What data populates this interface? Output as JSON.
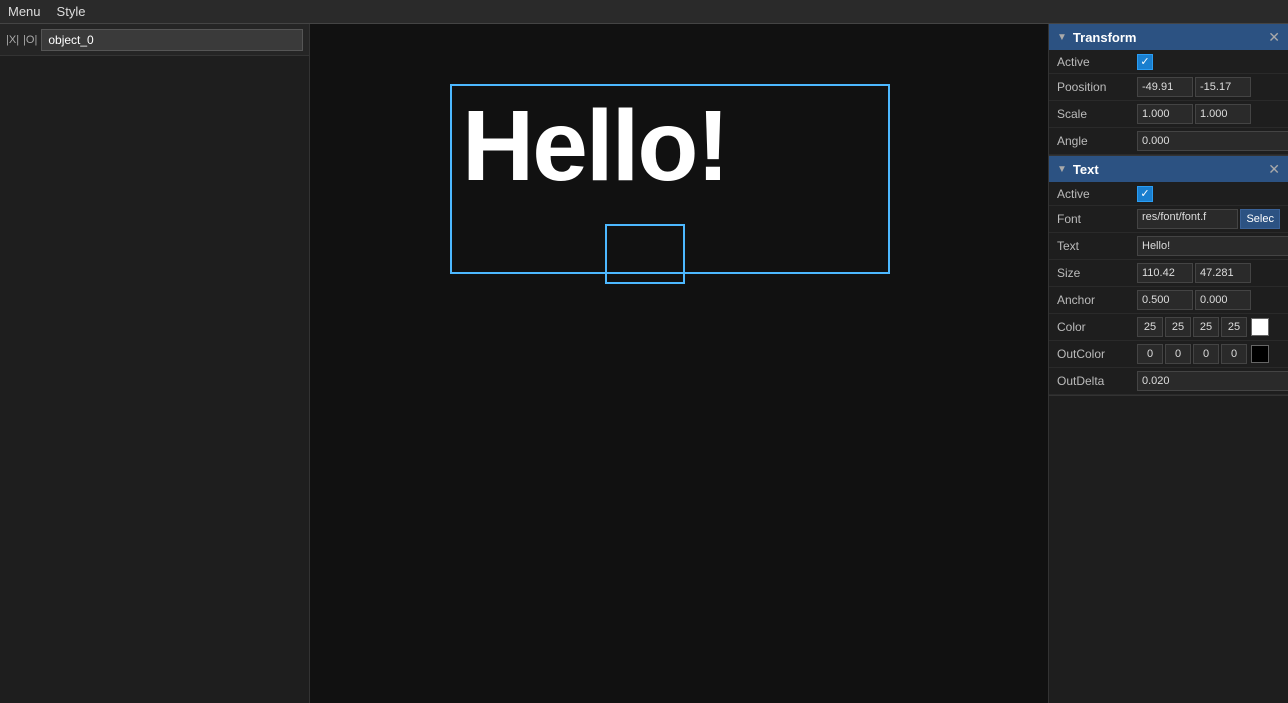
{
  "menubar": {
    "items": [
      "Menu",
      "Style"
    ]
  },
  "left_panel": {
    "icons": {
      "x": "|X|",
      "o": "|O|"
    },
    "object_name": "object_0"
  },
  "canvas": {
    "hello_text": "Hello!"
  },
  "right_panel": {
    "transform": {
      "title": "Transform",
      "active_label": "Active",
      "active_checked": true,
      "position_label": "Poosition",
      "position_x": "-49.91",
      "position_y": "-15.17",
      "scale_label": "Scale",
      "scale_x": "1.000",
      "scale_y": "1.000",
      "angle_label": "Angle",
      "angle_value": "0.000"
    },
    "text": {
      "title": "Text",
      "active_label": "Active",
      "active_checked": true,
      "font_label": "Font",
      "font_path": "res/font/font.f",
      "font_select_btn": "Selec",
      "text_label": "Text",
      "text_value": "Hello!",
      "size_label": "Size",
      "size_w": "110.42",
      "size_h": "47.281",
      "anchor_label": "Anchor",
      "anchor_x": "0.500",
      "anchor_y": "0.000",
      "color_label": "Color",
      "color_r": "25",
      "color_g": "25",
      "color_b": "25",
      "color_a": "25",
      "color_swatch": "#ffffff",
      "outcolor_label": "OutColor",
      "outcolor_r": "0",
      "outcolor_g": "0",
      "outcolor_b": "0",
      "outcolor_a": "0",
      "outcolor_swatch": "#000000",
      "outdelta_label": "OutDelta",
      "outdelta_value": "0.020"
    }
  }
}
